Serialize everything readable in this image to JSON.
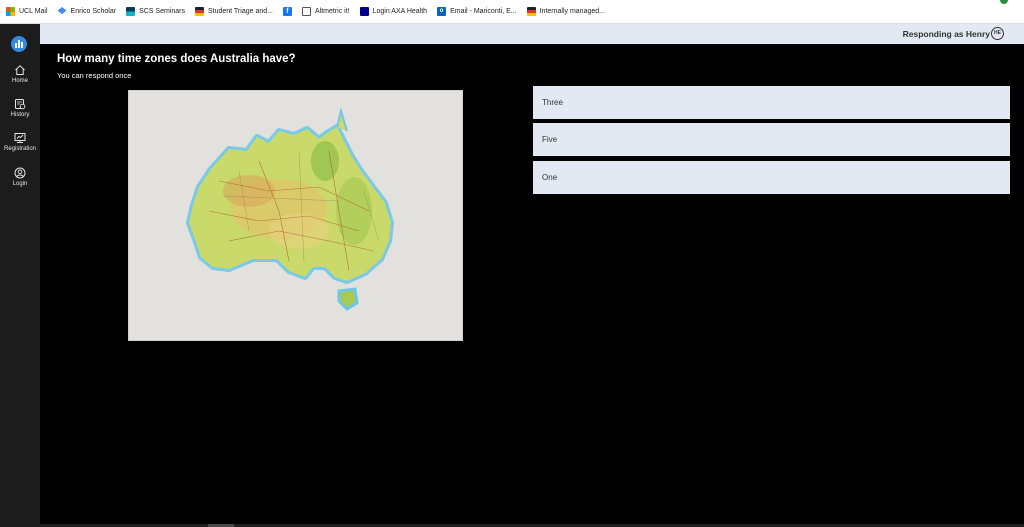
{
  "bookmarks": [
    {
      "label": "UCL Mail",
      "icon": "microsoft-icon"
    },
    {
      "label": "Enrico Scholar",
      "icon": "scholar-icon"
    },
    {
      "label": "SCS Seminars",
      "icon": "scs-icon"
    },
    {
      "label": "Student Triage and...",
      "icon": "stripe-icon"
    },
    {
      "label": "",
      "icon": "facebook-icon"
    },
    {
      "label": "Altmetric it!",
      "icon": "globe-icon"
    },
    {
      "label": "Login AXA Health",
      "icon": "axa-icon"
    },
    {
      "label": "Email - Mariconti, E...",
      "icon": "outlook-icon"
    },
    {
      "label": "Internally managed...",
      "icon": "stripe-icon"
    }
  ],
  "sidebar": {
    "items": [
      {
        "label": "Home",
        "icon": "home-icon"
      },
      {
        "label": "History",
        "icon": "history-icon"
      },
      {
        "label": "Registration",
        "icon": "registration-icon"
      },
      {
        "label": "Login",
        "icon": "user-icon"
      }
    ]
  },
  "header": {
    "responding_text": "Responding as Henry",
    "avatar_initials": "HE"
  },
  "question": {
    "title": "How many time zones does Australia have?",
    "subtitle": "You can respond once",
    "image": "australia-map"
  },
  "options": [
    {
      "label": "Three"
    },
    {
      "label": "Five"
    },
    {
      "label": "One"
    }
  ],
  "colors": {
    "background": "#000000",
    "sidebar": "#1c1c1c",
    "option_bg": "#e3e9f2",
    "accent": "#2f8be0"
  }
}
